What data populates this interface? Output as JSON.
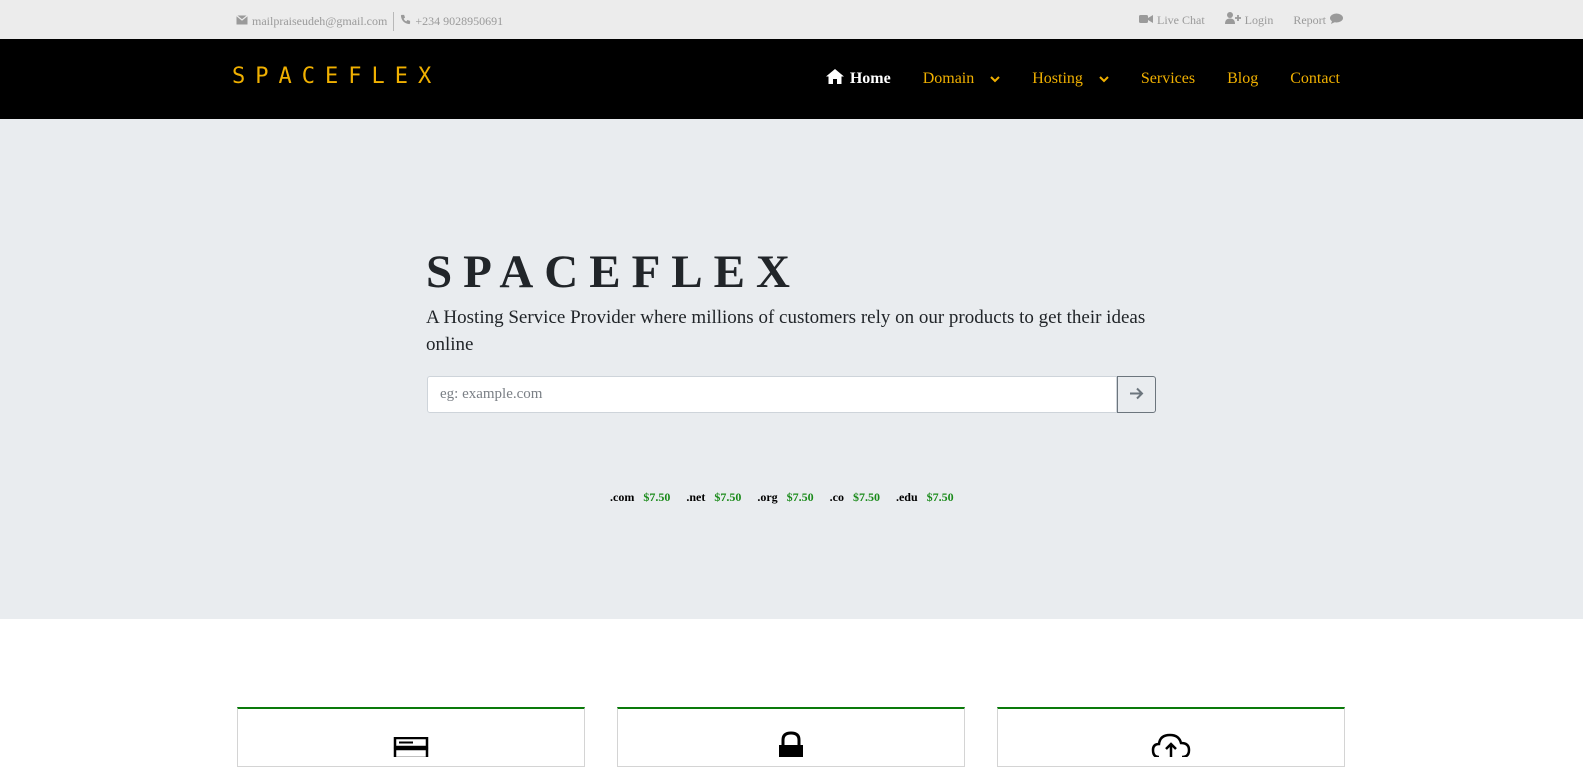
{
  "topbar": {
    "email": "mailpraiseudeh@gmail.com",
    "phone": "+234 9028950691",
    "live_chat": "Live Chat",
    "login": "Login",
    "report": "Report",
    "icons": [
      "envelope-icon",
      "phone-icon",
      "video-icon",
      "user-plus-icon",
      "comment-icon"
    ]
  },
  "navbar": {
    "brand": "SPACEFLEX",
    "items": [
      {
        "label": "Home",
        "icon": "home-icon",
        "active": true
      },
      {
        "label": "Domain",
        "dropdown": true
      },
      {
        "label": "Hosting",
        "dropdown": true
      },
      {
        "label": "Services"
      },
      {
        "label": "Blog"
      },
      {
        "label": "Contact"
      }
    ]
  },
  "hero": {
    "title": "SPACEFLEX",
    "subtitle": "A Hosting Service Provider where millions of customers rely on our products to get their ideas online",
    "search_placeholder": "eg: example.com",
    "search_button_icon": "arrow-right-icon"
  },
  "domain_prices": [
    {
      "tld": ".com",
      "price": "$7.50"
    },
    {
      "tld": ".net",
      "price": "$7.50"
    },
    {
      "tld": ".org",
      "price": "$7.50"
    },
    {
      "tld": ".co",
      "price": "$7.50"
    },
    {
      "tld": ".edu",
      "price": "$7.50"
    }
  ],
  "features": [
    {
      "icon": "server-icon"
    },
    {
      "icon": "lock-icon"
    },
    {
      "icon": "cloud-upload-icon"
    }
  ],
  "colors": {
    "topbar_bg": "#ececec",
    "navbar_bg": "#000000",
    "accent": "#f0b000",
    "hero_bg": "#e9ecef",
    "price": "#1a8a1a",
    "card_border": "#0a7a0a"
  }
}
